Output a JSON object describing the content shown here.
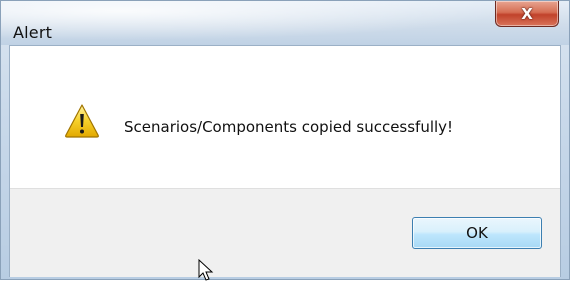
{
  "window": {
    "title": "Alert",
    "close_label": "X"
  },
  "dialog": {
    "icon": "warning-icon",
    "message": "Scenarios/Components copied successfully!"
  },
  "buttons": {
    "ok_label": "OK"
  },
  "colors": {
    "close_button": "#c9472f",
    "ok_button_border": "#3c7fb1",
    "footer_background": "#f0f0f0",
    "warning_yellow": "#f6d02a"
  }
}
